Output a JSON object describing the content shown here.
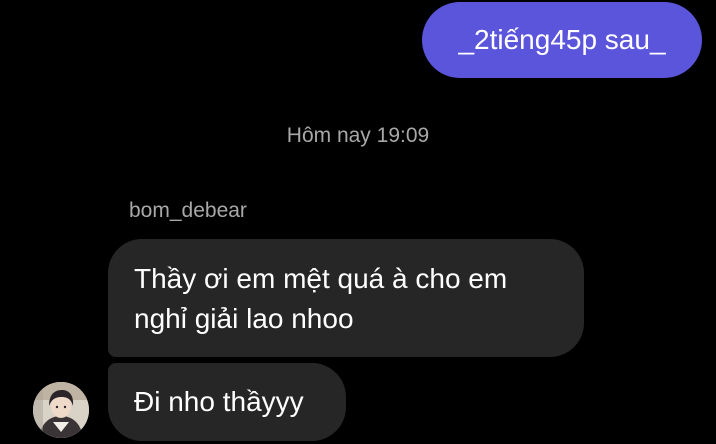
{
  "conversation": {
    "outgoing_message": "_2tiếng45p sau_",
    "timestamp": "Hôm nay 19:09",
    "sender_name": "bom_debear",
    "incoming_messages": [
      {
        "line1": "Thầy ơi em mệt quá à cho em",
        "line2": "nghỉ giải lao nhoo"
      },
      {
        "line1": "Đi nho thầyyy"
      }
    ],
    "avatar_icon": "user-photo-avatar"
  },
  "colors": {
    "background": "#000000",
    "outgoing_bubble": "#5b55dc",
    "incoming_bubble": "#262626",
    "meta_text": "#a8a8a8",
    "message_text": "#ffffff"
  }
}
